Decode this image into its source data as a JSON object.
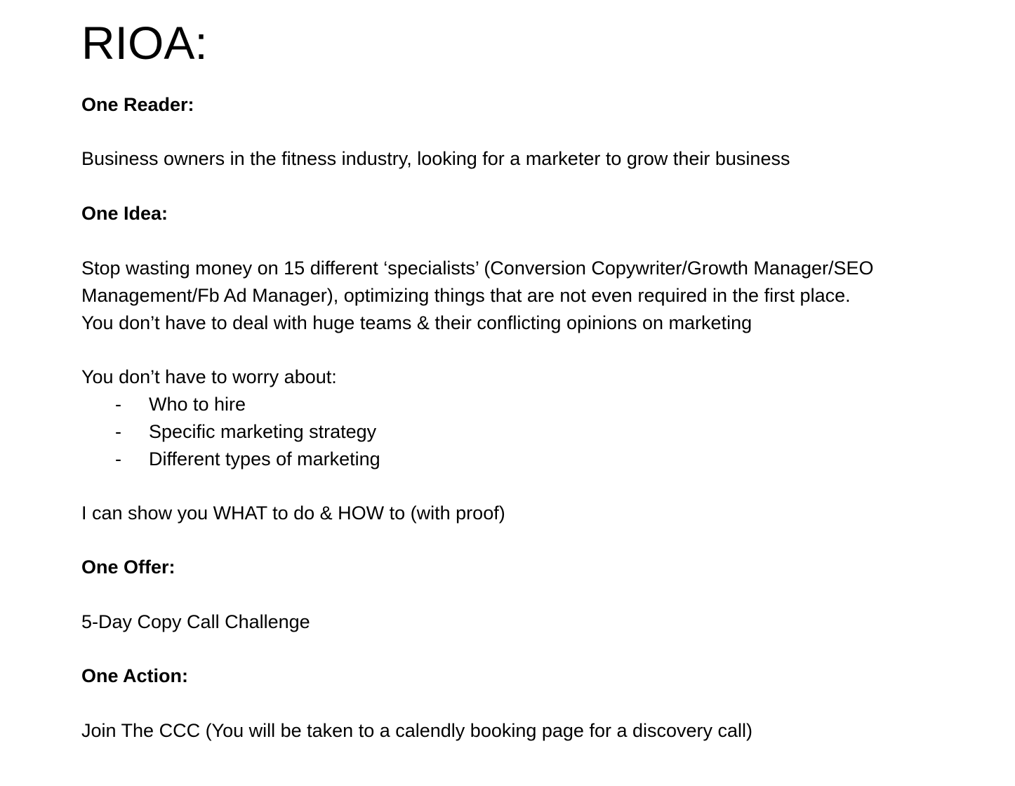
{
  "document": {
    "title": "RIOA:",
    "sections": {
      "reader": {
        "heading": "One Reader:",
        "text": "Business owners in the fitness industry, looking for a marketer to grow their business"
      },
      "idea": {
        "heading": "One Idea:",
        "paragraph_lines": [
          "Stop wasting money on 15 different ‘specialists’ (Conversion Copywriter/Growth Manager/SEO",
          "Management/Fb Ad Manager), optimizing things that are not even required in the first place.",
          "You don’t have to deal with huge teams & their conflicting opinions on marketing"
        ],
        "worry_intro": "You don’t have to worry about:",
        "bullet_marker": "-",
        "worry_items": [
          "Who to hire",
          "Specific marketing strategy",
          "Different types of marketing"
        ],
        "closing": "I can show you WHAT to do & HOW to (with proof)"
      },
      "offer": {
        "heading": "One Offer:",
        "text": "5-Day Copy Call Challenge"
      },
      "action": {
        "heading": "One Action:",
        "text": "Join The CCC (You will be taken to a calendly booking page for a discovery call)"
      }
    }
  }
}
